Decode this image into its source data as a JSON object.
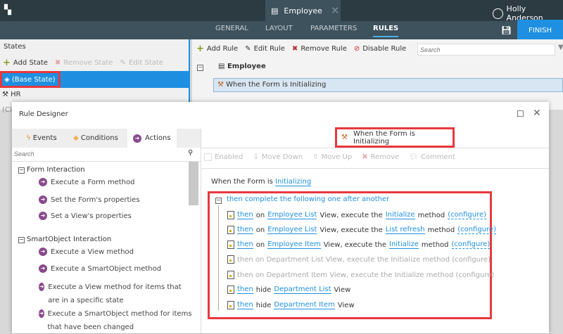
{
  "header": {
    "doc_title": "Employee",
    "user": "Holly Anderson",
    "tabs": [
      "GENERAL",
      "LAYOUT",
      "PARAMETERS",
      "RULES"
    ],
    "active_tab": "RULES",
    "finish": "FINISH"
  },
  "states": {
    "title": "States",
    "add": "Add State",
    "remove": "Remove State",
    "edit": "Edit State",
    "items": [
      "(Base State)",
      "HR"
    ],
    "truncated": "(Cli"
  },
  "rules_panel": {
    "add": "Add Rule",
    "edit": "Edit Rule",
    "remove": "Remove Rule",
    "disable": "Disable Rule",
    "search_placeholder": "Search",
    "form": "Employee",
    "rule": "When the Form is Initializing"
  },
  "dialog": {
    "title": "Rule Designer",
    "tabs": [
      "Events",
      "Conditions",
      "Actions"
    ],
    "search_placeholder": "Search",
    "groups": [
      {
        "name": "Form Interaction",
        "items": [
          "Execute a Form method",
          "Set the Form's properties",
          "Set a View's properties"
        ]
      },
      {
        "name": "SmartObject Interaction",
        "items": [
          "Execute a View method",
          "Execute a SmartObject method",
          "Execute a View method for items that are in a specific state",
          "Execute a SmartObject method for items that have been changed"
        ]
      }
    ],
    "rule_title": "When the Form is Initializing",
    "toolbar": {
      "enabled": "Enabled",
      "move_down": "Move Down",
      "move_up": "Move Up",
      "remove": "Remove",
      "comment": "Comment"
    },
    "when_prefix": "When the Form is",
    "when_link": "Initializing",
    "sequence": "then complete the following one after another",
    "actions": [
      {
        "then": "then",
        "a": "on",
        "l1": "Employee List",
        "b": "View, execute the",
        "l2": "Initialize",
        "c": "method",
        "cfg": "(configure)"
      },
      {
        "then": "then",
        "a": "on",
        "l1": "Employee List",
        "b": "View, execute the",
        "l2": "List refresh",
        "c": "method",
        "cfg": "(configure)"
      },
      {
        "then": "then",
        "a": "on",
        "l1": "Employee Item",
        "b": "View, execute the",
        "l2": "Initialize",
        "c": "method",
        "cfg": "(configure)"
      },
      {
        "text": "then on Department List View, execute the Initialize method (configure)"
      },
      {
        "text": "then on Department Item View, execute the Initialize method (configure)"
      },
      {
        "then": "then",
        "a": "hide",
        "l1": "Department List",
        "b": "View"
      },
      {
        "then": "then",
        "a": "hide",
        "l1": "Department Item",
        "b": "View"
      }
    ]
  }
}
